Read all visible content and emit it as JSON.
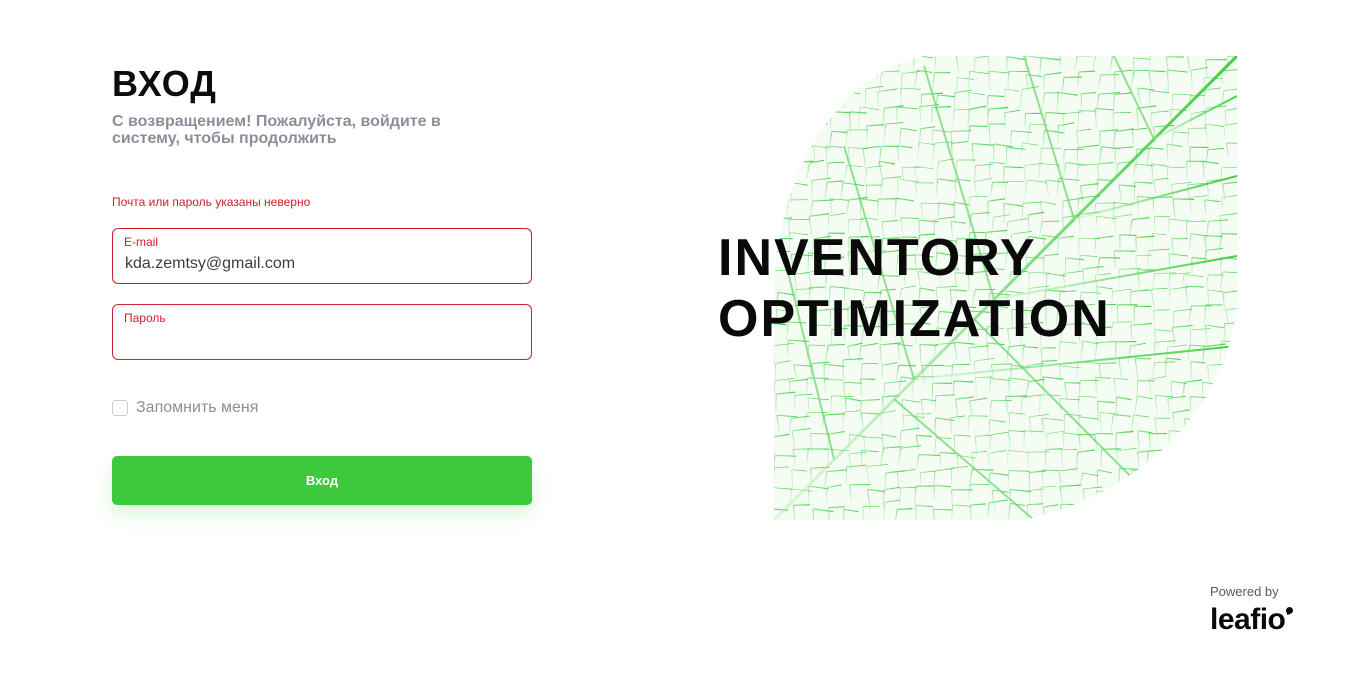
{
  "login": {
    "title": "ВХОД",
    "subtitle": "С возвращением! Пожалуйста, войдите в систему, чтобы продолжить",
    "error_message": "Почта или пароль указаны неверно",
    "email": {
      "label": "E-mail",
      "value": "kda.zemtsy@gmail.com"
    },
    "password": {
      "label": "Пароль",
      "value": ""
    },
    "remember_me": {
      "label": "Запомнить меня",
      "checked": false
    },
    "submit_label": "Вход"
  },
  "hero": {
    "title_line1": "INVENTORY",
    "title_line2": "OPTIMIZATION",
    "image": "green-leaf-veins"
  },
  "footer": {
    "powered_by": "Powered by",
    "brand": "leafio"
  },
  "colors": {
    "error": "#d0202e",
    "accent_green": "#3cc93c",
    "text_muted": "#8a8f9a"
  }
}
